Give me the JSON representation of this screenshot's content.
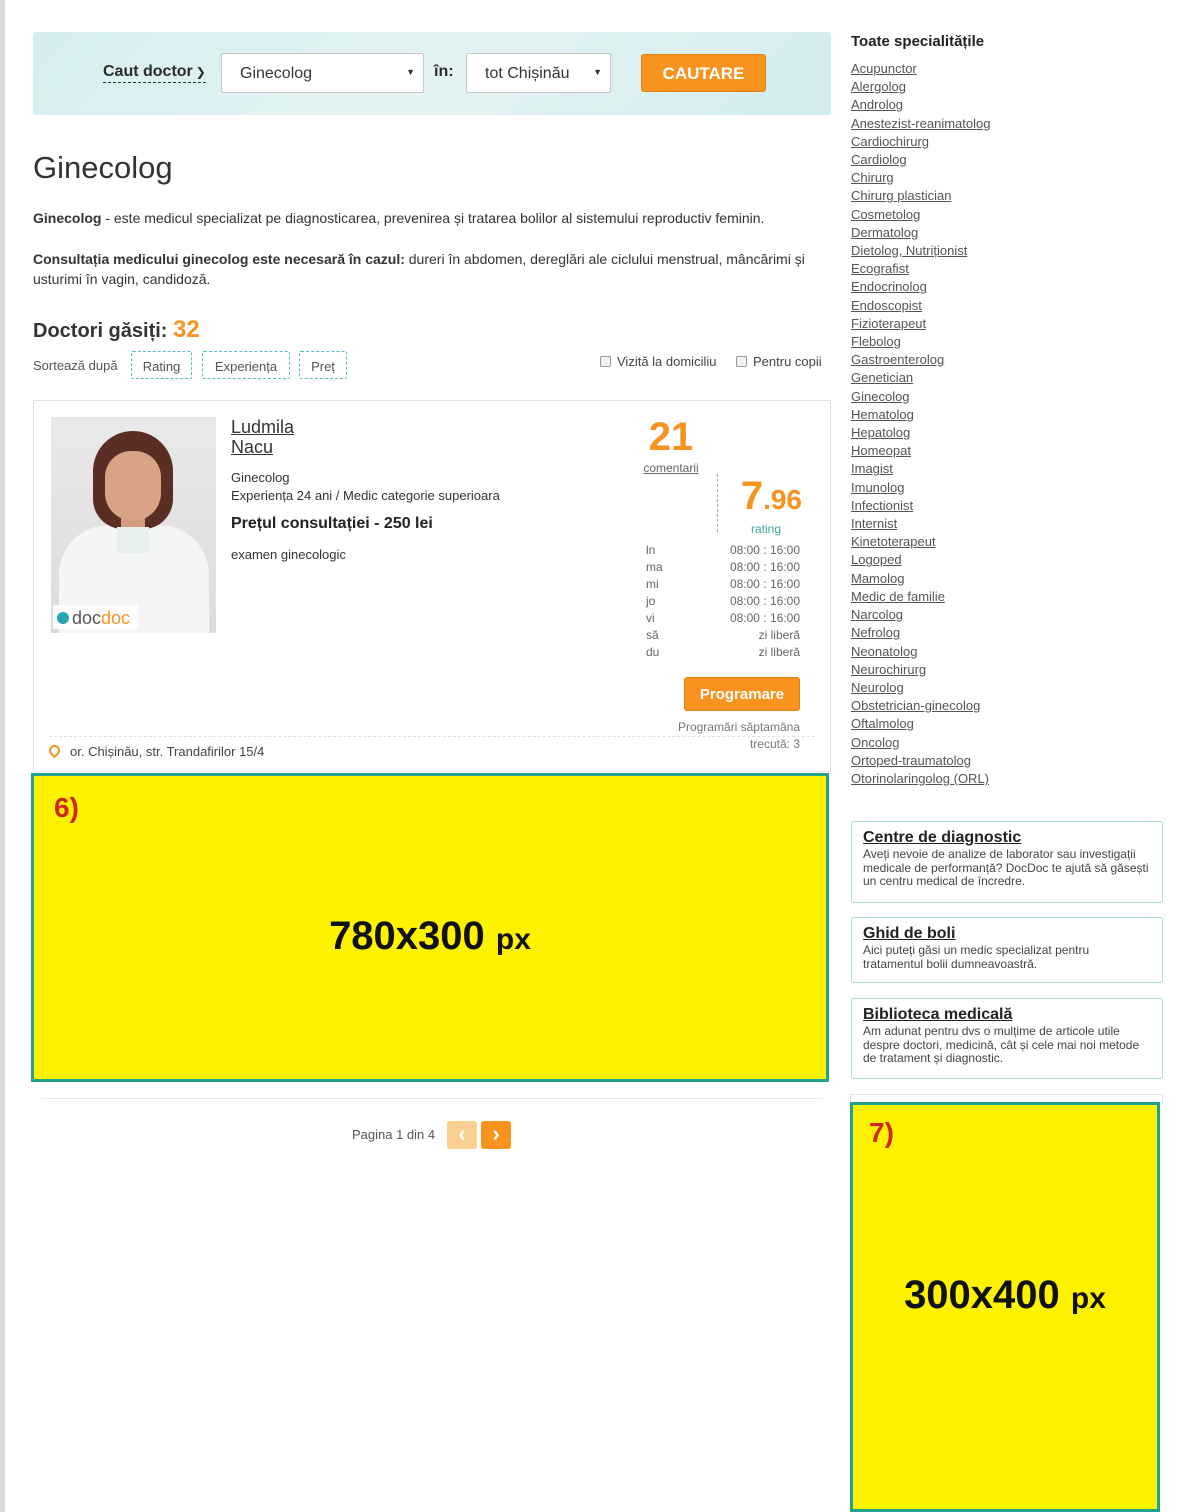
{
  "search": {
    "mode_label": "Caut doctor",
    "specialty_value": "Ginecolog",
    "in_label": "în:",
    "location_value": "tot Chișinău",
    "button_label": "CAUTARE"
  },
  "page": {
    "title": "Ginecolog",
    "desc1_bold": "Ginecolog",
    "desc1_rest": " - este medicul specializat pe diagnosticarea, prevenirea și tratarea bolilor al sistemului reproductiv feminin.",
    "desc2_bold": "Consultația medicului ginecolog este necesară în cazul:",
    "desc2_rest": " dureri în abdomen, dereglări ale ciclului menstrual, mâncărimi și usturimi în vagin, candidoză.",
    "found_label": "Doctori găsiți:",
    "found_count": "32"
  },
  "sort": {
    "label": "Sortează după",
    "options": [
      "Rating",
      "Experiența",
      "Preț"
    ]
  },
  "filters": {
    "home_visit": "Vizită la domiciliu",
    "for_children": "Pentru copii"
  },
  "doctor": {
    "first_name": "Ludmila",
    "last_name": "Nacu",
    "specialty": "Ginecolog",
    "experience": "Experiența 24 ani / Medic categorie superioara",
    "price": "Prețul consultației - 250 lei",
    "service": "examen ginecologic",
    "comments_count": "21",
    "comments_label": "comentarii",
    "rating_int": "7",
    "rating_dec": ".96",
    "rating_label": "rating",
    "photo_logo_a": "doc",
    "photo_logo_b": "doc",
    "schedule": [
      {
        "day": "ln",
        "hours": "08:00 : 16:00"
      },
      {
        "day": "ma",
        "hours": "08:00 : 16:00"
      },
      {
        "day": "mi",
        "hours": "08:00 : 16:00"
      },
      {
        "day": "jo",
        "hours": "08:00 : 16:00"
      },
      {
        "day": "vi",
        "hours": "08:00 : 16:00"
      },
      {
        "day": "să",
        "hours": "zi liberă"
      },
      {
        "day": "du",
        "hours": "zi liberă"
      }
    ],
    "book_button": "Programare",
    "bookings_line1": "Programări săptamâna",
    "bookings_line2": "trecută: 3",
    "address": "or. Chișinău, str. Trandafirilor 15/4"
  },
  "ads": {
    "main": {
      "tag": "6)",
      "size": "780x300",
      "unit": "px"
    },
    "side": {
      "tag": "7)",
      "size": "300x400",
      "unit": "px"
    }
  },
  "pagination": {
    "text": "Pagina 1 din 4",
    "prev": "‹",
    "next": "›"
  },
  "sidebar": {
    "title": "Toate specialitățile",
    "specialties": [
      "Acupunctor",
      "Alergolog",
      "Androlog",
      "Anestezist-reanimatolog",
      "Cardiochirurg",
      "Cardiolog",
      "Chirurg",
      "Chirurg plastician",
      "Cosmetolog",
      "Dermatolog",
      "Dietolog, Nutriționist",
      "Ecografist",
      "Endocrinolog",
      "Endoscopist",
      "Fizioterapeut",
      "Flebolog",
      "Gastroenterolog",
      "Genetician",
      "Ginecolog",
      "Hematolog",
      "Hepatolog",
      "Homeopat",
      "Imagist",
      "Imunolog",
      "Infectionist",
      "Internist",
      "Kinetoterapeut",
      "Logoped",
      "Mamolog",
      "Medic de familie",
      "Narcolog",
      "Nefrolog",
      "Neonatolog",
      "Neurochirurg",
      "Neurolog",
      "Obstetrician-ginecolog",
      "Oftalmolog",
      "Oncolog",
      "Ortoped-traumatolog",
      "Otorinolaringolog (ORL)"
    ],
    "boxes": [
      {
        "title": "Centre de diagnostic",
        "text": "Aveți nevoie de analize de laborator sau investigații medicale de performanță? DocDoc te ajută să găsești un centru medical de încredre."
      },
      {
        "title": "Ghid de boli",
        "text": "Aici puteți găsi un medic specializat pentru tratamentul bolii dumneavoastră."
      },
      {
        "title": "Biblioteca medicală",
        "text": "Am adunat pentru dvs o mulțime de articole utile despre doctori, medicină, cât și cele mai noi metode de tratament și diagnostic."
      }
    ]
  },
  "icons": {
    "mode_chevron": "chevron-down-icon",
    "select_arrow": "dropdown-arrow-icon",
    "address": "map-pin-icon",
    "checkbox": "checkbox-icon"
  },
  "colors": {
    "accent_orange": "#f7931e",
    "teal": "#21a18e",
    "placeholder_yellow": "#fff200",
    "placeholder_label_red": "#d0261b"
  }
}
